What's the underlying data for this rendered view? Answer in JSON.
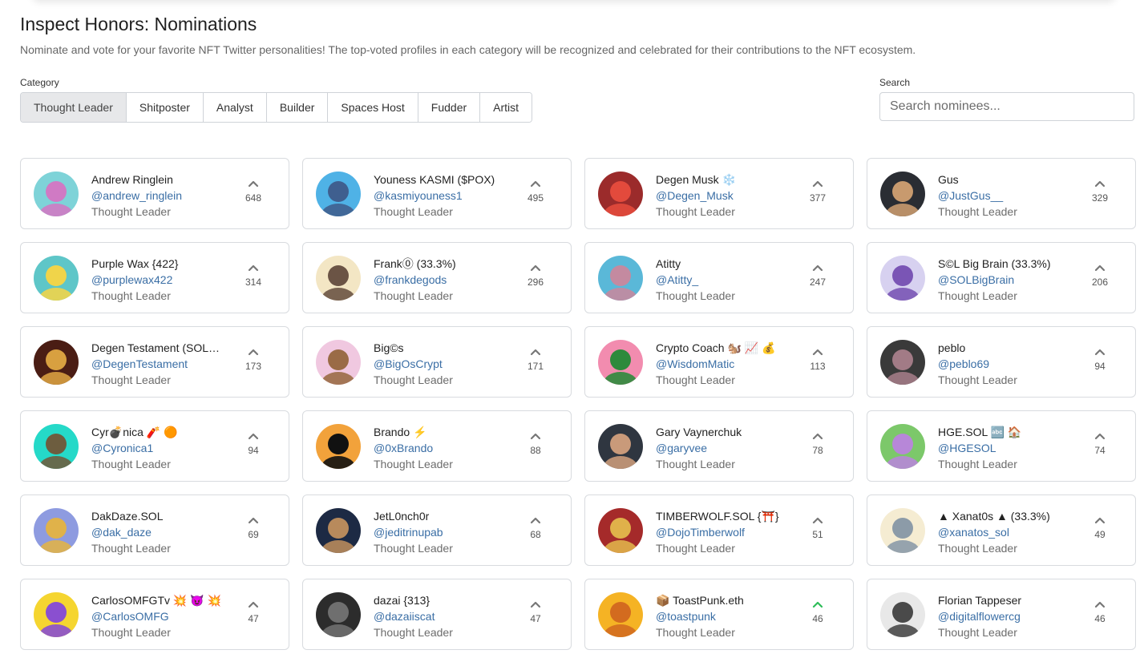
{
  "page": {
    "title": "Inspect Honors: Nominations",
    "description": "Nominate and vote for your favorite NFT Twitter personalities! The top-voted profiles in each category will be recognized and celebrated for their contributions to the NFT ecosystem.",
    "category_label": "Category",
    "search_label": "Search",
    "search_placeholder": "Search nominees...",
    "search_value": ""
  },
  "colors": {
    "upvote": "#777777",
    "upvote_active": "#2ebd59",
    "handle": "#3a6ea5",
    "active_tab_bg": "#e7e8ea"
  },
  "tabs": [
    {
      "label": "Thought Leader",
      "active": true
    },
    {
      "label": "Shitposter",
      "active": false
    },
    {
      "label": "Analyst",
      "active": false
    },
    {
      "label": "Builder",
      "active": false
    },
    {
      "label": "Spaces Host",
      "active": false
    },
    {
      "label": "Fudder",
      "active": false
    },
    {
      "label": "Artist",
      "active": false
    }
  ],
  "nominees": [
    {
      "name": "Andrew Ringlein",
      "handle": "@andrew_ringlein",
      "category": "Thought Leader",
      "votes": "648",
      "bg": "#7ed3d8",
      "fg": "#d07ac4",
      "upvoted": false
    },
    {
      "name": "Youness KASMI ($POX)",
      "handle": "@kasmiyouness1",
      "category": "Thought Leader",
      "votes": "495",
      "bg": "#4fb2e6",
      "fg": "#3f5f8f",
      "upvoted": false
    },
    {
      "name": "Degen Musk ❄️",
      "handle": "@Degen_Musk",
      "category": "Thought Leader",
      "votes": "377",
      "bg": "#9b2b2b",
      "fg": "#e34a3c",
      "upvoted": false
    },
    {
      "name": "Gus",
      "handle": "@JustGus__",
      "category": "Thought Leader",
      "votes": "329",
      "bg": "#2a2d33",
      "fg": "#c89a6e",
      "upvoted": false
    },
    {
      "name": "Purple Wax {422}",
      "handle": "@purplewax422",
      "category": "Thought Leader",
      "votes": "314",
      "bg": "#5ec6c8",
      "fg": "#f0d44a",
      "upvoted": false
    },
    {
      "name": "Frank⓪ (33.3%)",
      "handle": "@frankdegods",
      "category": "Thought Leader",
      "votes": "296",
      "bg": "#f3e6c4",
      "fg": "#6b5445",
      "upvoted": false
    },
    {
      "name": "Atitty",
      "handle": "@Atitty_",
      "category": "Thought Leader",
      "votes": "247",
      "bg": "#5ab8d8",
      "fg": "#c48aa0",
      "upvoted": false
    },
    {
      "name": "S©L Big Brain (33.3%)",
      "handle": "@SOLBigBrain",
      "category": "Thought Leader",
      "votes": "206",
      "bg": "#d7d1f0",
      "fg": "#7a55b5",
      "upvoted": false
    },
    {
      "name": "Degen Testament (SOL…",
      "handle": "@DegenTestament",
      "category": "Thought Leader",
      "votes": "173",
      "bg": "#4a1d14",
      "fg": "#d8a040",
      "upvoted": false
    },
    {
      "name": "Big©s",
      "handle": "@BigOsCrypt",
      "category": "Thought Leader",
      "votes": "171",
      "bg": "#f0c8e0",
      "fg": "#9a6b46",
      "upvoted": false
    },
    {
      "name": "Crypto Coach 🐿️ 📈 💰",
      "handle": "@WisdomMatic",
      "category": "Thought Leader",
      "votes": "113",
      "bg": "#f28caf",
      "fg": "#2d8a3c",
      "upvoted": false
    },
    {
      "name": "peblo",
      "handle": "@peblo69",
      "category": "Thought Leader",
      "votes": "94",
      "bg": "#3a3a3a",
      "fg": "#a27b86",
      "upvoted": false
    },
    {
      "name": "Cyr💣nica 🧨 🟠",
      "handle": "@Cyronica1",
      "category": "Thought Leader",
      "votes": "94",
      "bg": "#25d9c8",
      "fg": "#6d5d3f",
      "upvoted": false
    },
    {
      "name": "Brando ⚡",
      "handle": "@0xBrando",
      "category": "Thought Leader",
      "votes": "88",
      "bg": "#f2a23b",
      "fg": "#111111",
      "upvoted": false
    },
    {
      "name": "Gary Vaynerchuk",
      "handle": "@garyvee",
      "category": "Thought Leader",
      "votes": "78",
      "bg": "#2f3640",
      "fg": "#c99a7a",
      "upvoted": false
    },
    {
      "name": "HGE.SOL 🔤 🏠",
      "handle": "@HGESOL",
      "category": "Thought Leader",
      "votes": "74",
      "bg": "#7cc86a",
      "fg": "#b787d8",
      "upvoted": false
    },
    {
      "name": "DakDaze.SOL",
      "handle": "@dak_daze",
      "category": "Thought Leader",
      "votes": "69",
      "bg": "#8e9be0",
      "fg": "#e0b24a",
      "upvoted": false
    },
    {
      "name": "JetL0nch0r",
      "handle": "@jeditrinupab",
      "category": "Thought Leader",
      "votes": "68",
      "bg": "#1d2a44",
      "fg": "#b88a5c",
      "upvoted": false
    },
    {
      "name": "TIMBERWOLF.SOL {⛩️}",
      "handle": "@DojoTimberwolf",
      "category": "Thought Leader",
      "votes": "51",
      "bg": "#a52a2a",
      "fg": "#e0b14a",
      "upvoted": false
    },
    {
      "name": "▲ Xanat0s ▲ (33.3%)",
      "handle": "@xanatos_sol",
      "category": "Thought Leader",
      "votes": "49",
      "bg": "#f5ecd2",
      "fg": "#8c9ba8",
      "upvoted": false
    },
    {
      "name": "CarlosOMFGTv 💥 😈 💥",
      "handle": "@CarlosOMFG",
      "category": "Thought Leader",
      "votes": "47",
      "bg": "#f5d530",
      "fg": "#8a4fd0",
      "upvoted": false
    },
    {
      "name": "dazai {313}",
      "handle": "@dazaiiscat",
      "category": "Thought Leader",
      "votes": "47",
      "bg": "#2c2c2c",
      "fg": "#6f6f6f",
      "upvoted": false
    },
    {
      "name": "📦 ToastPunk.eth",
      "handle": "@toastpunk",
      "category": "Thought Leader",
      "votes": "46",
      "bg": "#f5b324",
      "fg": "#d36b1f",
      "upvoted": true
    },
    {
      "name": "Florian Tappeser",
      "handle": "@digitalflowercg",
      "category": "Thought Leader",
      "votes": "46",
      "bg": "#e8e8e8",
      "fg": "#4a4a4a",
      "upvoted": false
    }
  ]
}
